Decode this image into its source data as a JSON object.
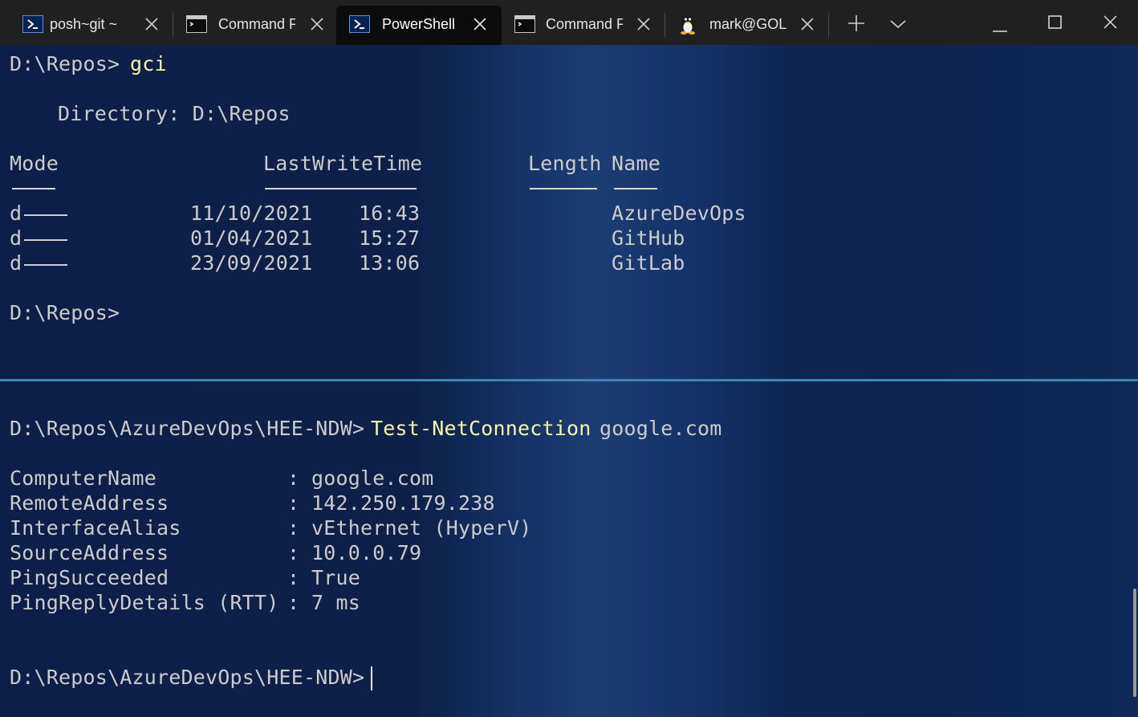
{
  "tabs": [
    {
      "label": "posh~git ~",
      "icon": "powershell-icon",
      "active": false
    },
    {
      "label": "Command P",
      "icon": "command-prompt-icon",
      "active": false
    },
    {
      "label": "PowerShell",
      "icon": "powershell-icon",
      "active": true
    },
    {
      "label": "Command P",
      "icon": "command-prompt-icon",
      "active": false
    },
    {
      "label": "mark@GOLI",
      "icon": "linux-penguin-icon",
      "active": false
    }
  ],
  "top_pane": {
    "prompt": "D:\\Repos>",
    "command": "gci",
    "directory_line": "Directory: D:\\Repos",
    "headers": {
      "mode": "Mode",
      "last_write_time": "LastWriteTime",
      "length": "Length",
      "name": "Name"
    },
    "rows": [
      {
        "mode": "d",
        "date": "11/10/2021",
        "time": "16:43",
        "name": "AzureDevOps"
      },
      {
        "mode": "d",
        "date": "01/04/2021",
        "time": "15:27",
        "name": "GitHub"
      },
      {
        "mode": "d",
        "date": "23/09/2021",
        "time": "13:06",
        "name": "GitLab"
      }
    ],
    "final_prompt": "D:\\Repos>"
  },
  "bottom_pane": {
    "prompt": "D:\\Repos\\AzureDevOps\\HEE-NDW>",
    "command": "Test-NetConnection",
    "argument": "google.com",
    "properties": [
      {
        "key": "ComputerName",
        "value": "google.com"
      },
      {
        "key": "RemoteAddress",
        "value": "142.250.179.238"
      },
      {
        "key": "InterfaceAlias",
        "value": "vEthernet (HyperV)"
      },
      {
        "key": "SourceAddress",
        "value": "10.0.0.79"
      },
      {
        "key": "PingSucceeded",
        "value": "True"
      },
      {
        "key": "PingReplyDetails (RTT)",
        "value": "7 ms"
      }
    ],
    "separator": ":",
    "final_prompt": "D:\\Repos\\AzureDevOps\\HEE-NDW>"
  },
  "colors": {
    "tabbar_bg": "#202020",
    "active_tab_bg": "#0c0c0c",
    "pane_bg": "#0c1f48",
    "text": "#cccccc",
    "command_text": "#f6f7a2",
    "divider": "#3a86b5"
  }
}
